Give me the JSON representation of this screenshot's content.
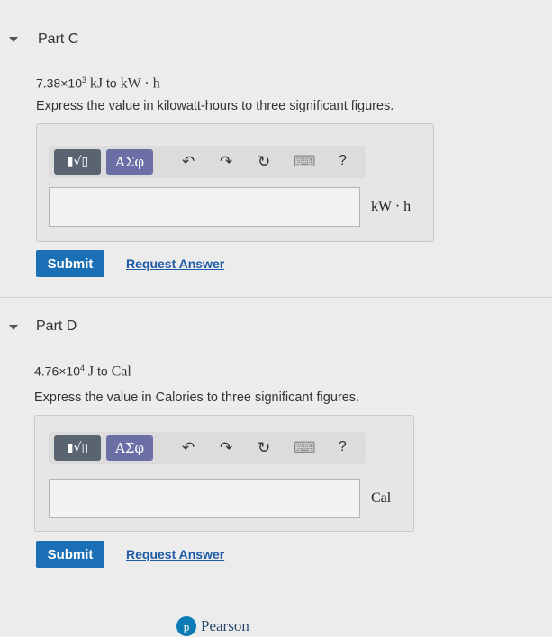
{
  "part_c": {
    "title": "Part C",
    "problem_prefix": "7.38×10",
    "problem_exp": "3",
    "problem_unit_from": "kJ",
    "problem_to": "to",
    "problem_unit_to": "kW · h",
    "instruction": "Express the value in kilowatt-hours to three significant figures.",
    "toolbar": {
      "templates_label": "▮√▯",
      "symbols_label": "ΑΣφ",
      "undo_icon": "↶",
      "redo_icon": "↷",
      "reset_icon": "↻",
      "keyboard_icon": "⌨",
      "help_label": "?"
    },
    "answer_value": "",
    "unit": "kW · h",
    "submit_label": "Submit",
    "request_label": "Request Answer"
  },
  "part_d": {
    "title": "Part D",
    "problem_prefix": "4.76×10",
    "problem_exp": "4",
    "problem_unit_from": "J",
    "problem_to": "to",
    "problem_unit_to": "Cal",
    "instruction": "Express the value in Calories to three significant figures.",
    "toolbar": {
      "templates_label": "▮√▯",
      "symbols_label": "ΑΣφ",
      "undo_icon": "↶",
      "redo_icon": "↷",
      "reset_icon": "↻",
      "keyboard_icon": "⌨",
      "help_label": "?"
    },
    "answer_value": "",
    "unit": "Cal",
    "submit_label": "Submit",
    "request_label": "Request Answer"
  },
  "footer": {
    "brand": "Pearson"
  },
  "colors": {
    "submit": "#1b6fb5",
    "link": "#1e5aa8",
    "symbols": "#6c6fa6",
    "templates": "#5a6470"
  }
}
